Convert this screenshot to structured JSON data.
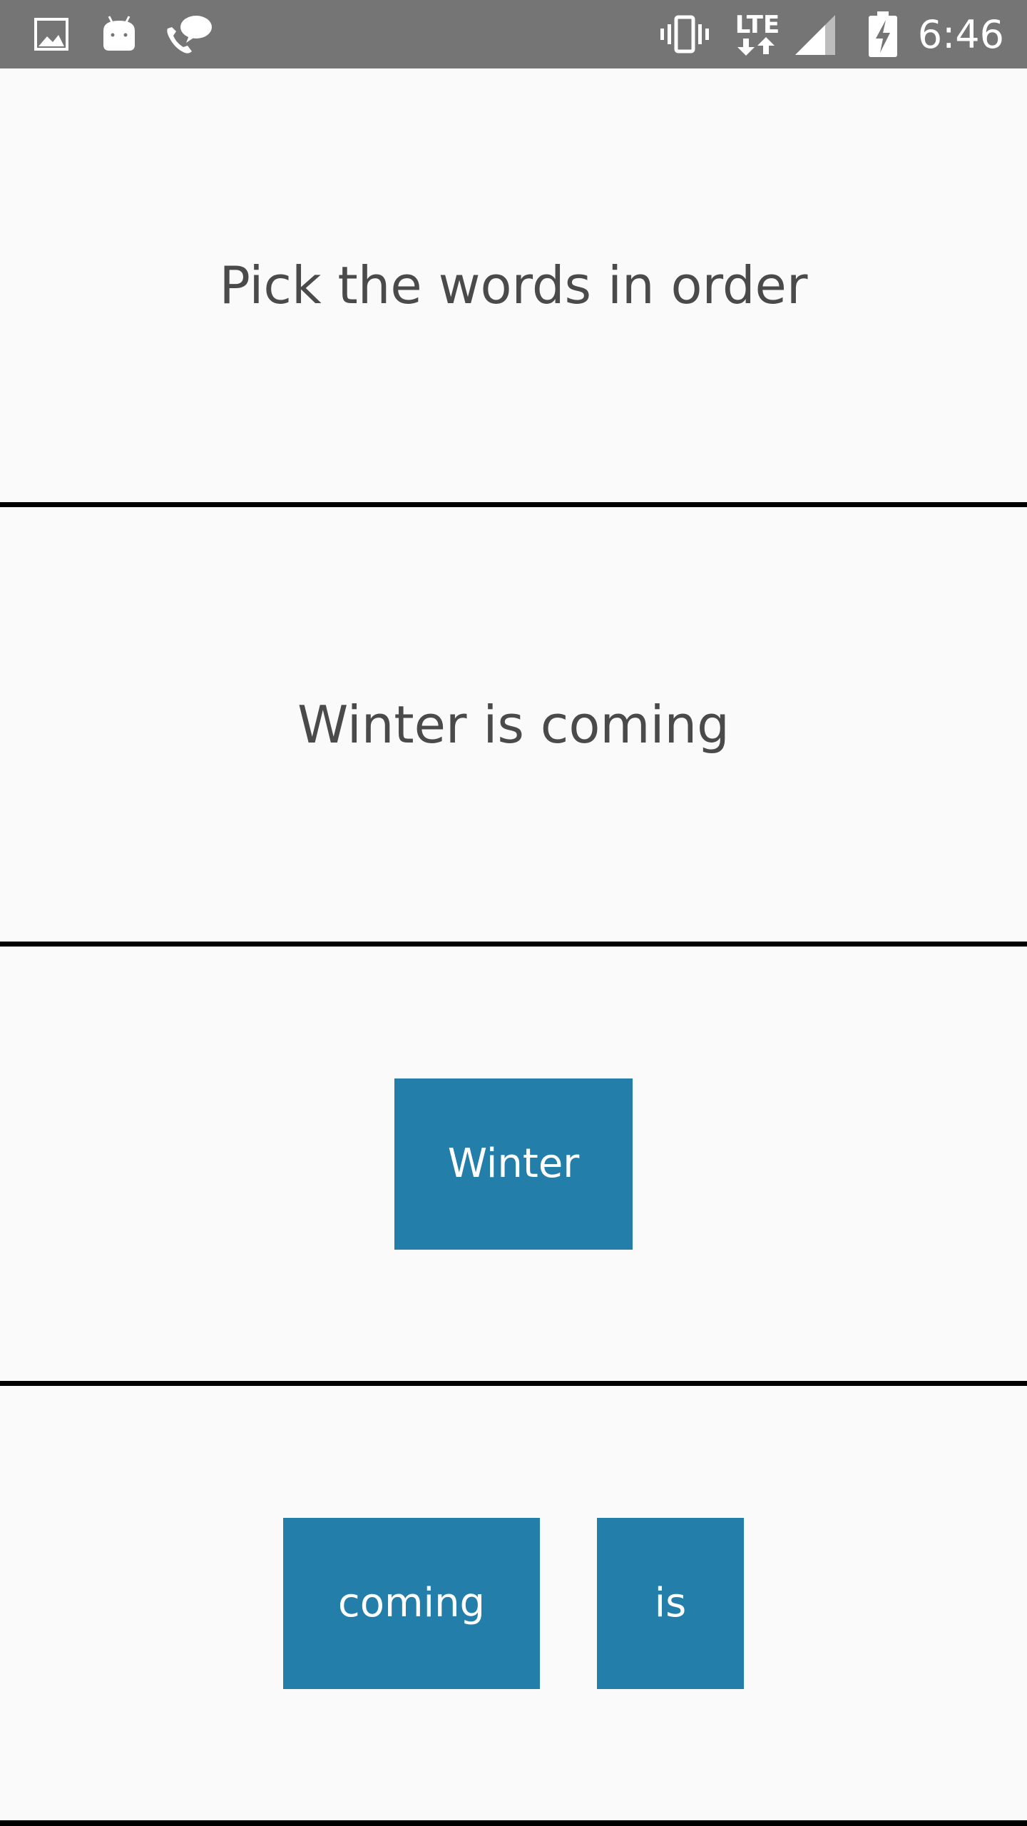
{
  "status_bar": {
    "time": "6:46",
    "network_label": "LTE",
    "icons": [
      "image-icon",
      "android-icon",
      "phone-chat-icon",
      "vibrate-icon",
      "lte-data-icon",
      "signal-icon",
      "battery-charging-icon"
    ]
  },
  "instruction": {
    "text": "Pick the words in order"
  },
  "target_sentence": {
    "text": "Winter is coming"
  },
  "answer_area": {
    "words": [
      "Winter"
    ]
  },
  "word_bank": {
    "words": [
      "coming",
      "is"
    ]
  },
  "colors": {
    "status_bar": "#757575",
    "background": "#fafafa",
    "word_button": "#237faa",
    "divider": "#000000",
    "text": "#4a4a4a"
  }
}
